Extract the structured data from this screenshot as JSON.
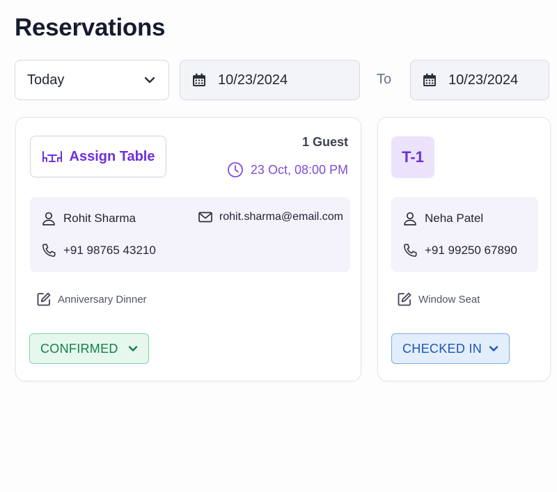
{
  "page": {
    "title": "Reservations"
  },
  "filters": {
    "period": "Today",
    "from_date": "10/23/2024",
    "to_label": "To",
    "to_date": "10/23/2024"
  },
  "colors": {
    "accent_purple": "#6d2ee0",
    "confirmed_green": "#138049",
    "checked_in_blue": "#1c56b5",
    "info_bg": "#f4f2fb"
  },
  "reservations": [
    {
      "assign_label": "Assign Table",
      "guests": "1 Guest",
      "time": "23 Oct, 08:00 PM",
      "name": "Rohit Sharma",
      "email": "rohit.sharma@email.com",
      "phone": "+91 98765 43210",
      "note": "Anniversary Dinner",
      "status": "CONFIRMED"
    },
    {
      "table": "T-1",
      "name": "Neha Patel",
      "phone": "+91 99250 67890",
      "note": "Window Seat",
      "status": "CHECKED IN"
    }
  ],
  "icons": [
    "chevron-down-icon",
    "calendar-icon",
    "table-icon",
    "clock-icon",
    "user-icon",
    "mail-icon",
    "phone-icon",
    "edit-icon"
  ]
}
